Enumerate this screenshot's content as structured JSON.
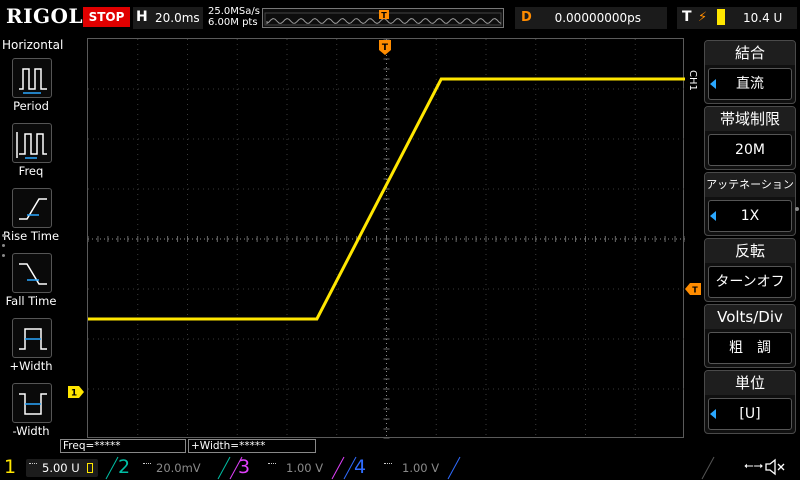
{
  "brand": "RIGOL",
  "run_state": "STOP",
  "horizontal": {
    "key": "H",
    "timebase": "20.0ms",
    "sample_rate": "25.0MSa/s",
    "memory_depth": "6.00M pts"
  },
  "memory_strip": {
    "trigger_marker": "T"
  },
  "delay": {
    "key": "D",
    "value": "0.00000000ps"
  },
  "trigger": {
    "key": "T",
    "level": "10.4 U",
    "color": "#ff8c00"
  },
  "left_menu": {
    "title": "Horizontal",
    "items": [
      {
        "label": "Period"
      },
      {
        "label": "Freq"
      },
      {
        "label": "Rise Time"
      },
      {
        "label": "Fall Time"
      },
      {
        "label": "+Width"
      },
      {
        "label": "-Width"
      }
    ]
  },
  "grid_markers": {
    "trigger_top": "T",
    "trigger_level_right": "T",
    "ch1_ground": "1"
  },
  "right_menu": {
    "channel": "CH1",
    "items": [
      {
        "header": "結合",
        "value": "直流"
      },
      {
        "header": "帯域制限",
        "value": "20M"
      },
      {
        "header": "アッテネーション",
        "value": "1X"
      },
      {
        "header": "反転",
        "value": "ターンオフ"
      },
      {
        "header": "Volts/Div",
        "value": "粗　調"
      },
      {
        "header": "単位",
        "value": "[U]"
      }
    ]
  },
  "measurements": [
    {
      "text": "Freq=*****"
    },
    {
      "text": "+Width=*****"
    }
  ],
  "channels": [
    {
      "num": "1",
      "scale": "5.00 U",
      "color": "#ffe600"
    },
    {
      "num": "2",
      "scale": "20.0mV",
      "color": "#00bfa5"
    },
    {
      "num": "3",
      "scale": "1.00 V",
      "color": "#e040fb"
    },
    {
      "num": "4",
      "scale": "1.00 V",
      "color": "#2f6cff"
    }
  ],
  "waveform": {
    "channel": "CH1",
    "low_level_div": -1.6,
    "high_level_div": 3.2,
    "rise_start_div": -1.4,
    "rise_end_div": 1.1
  }
}
